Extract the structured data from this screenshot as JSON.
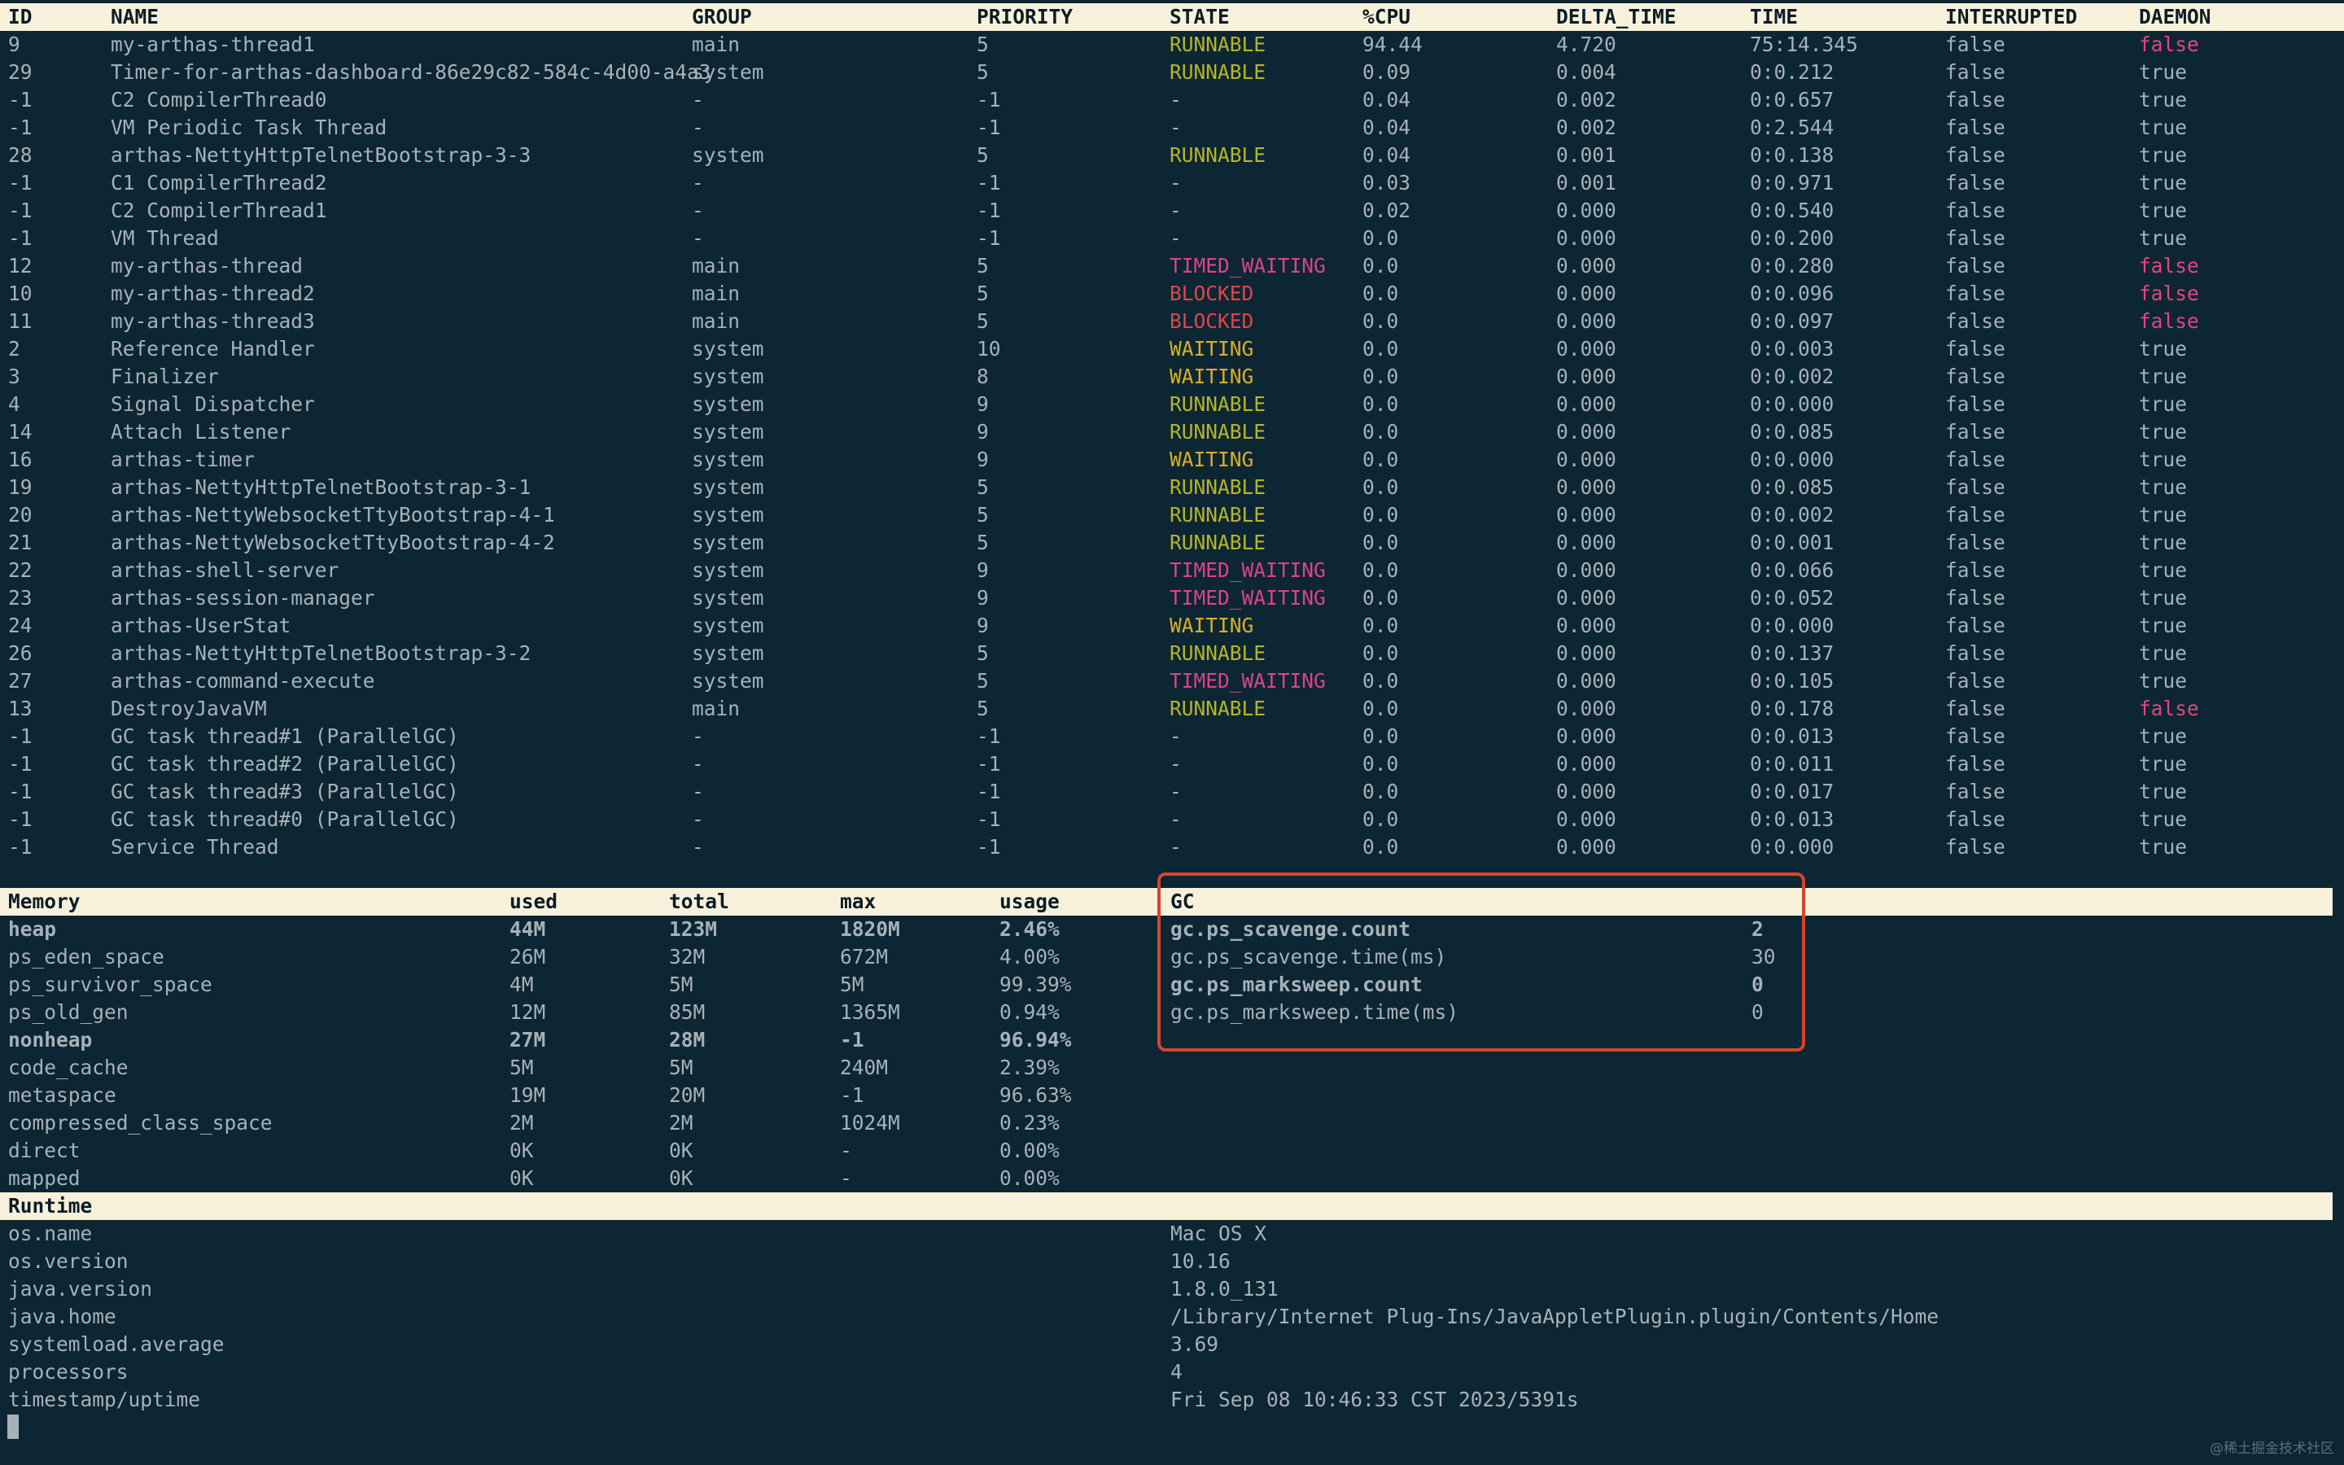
{
  "thread_table": {
    "headers": [
      "ID",
      "NAME",
      "GROUP",
      "PRIORITY",
      "STATE",
      "%CPU",
      "DELTA_TIME",
      "TIME",
      "INTERRUPTED",
      "DAEMON"
    ],
    "rows": [
      [
        "9",
        "my-arthas-thread1",
        "main",
        "5",
        "RUNNABLE",
        "94.44",
        "4.720",
        "75:14.345",
        "false",
        "false"
      ],
      [
        "29",
        "Timer-for-arthas-dashboard-86e29c82-584c-4d00-a4a3",
        "system",
        "5",
        "RUNNABLE",
        "0.09",
        "0.004",
        "0:0.212",
        "false",
        "true"
      ],
      [
        "-1",
        "C2 CompilerThread0",
        "-",
        "-1",
        "-",
        "0.04",
        "0.002",
        "0:0.657",
        "false",
        "true"
      ],
      [
        "-1",
        "VM Periodic Task Thread",
        "-",
        "-1",
        "-",
        "0.04",
        "0.002",
        "0:2.544",
        "false",
        "true"
      ],
      [
        "28",
        "arthas-NettyHttpTelnetBootstrap-3-3",
        "system",
        "5",
        "RUNNABLE",
        "0.04",
        "0.001",
        "0:0.138",
        "false",
        "true"
      ],
      [
        "-1",
        "C1 CompilerThread2",
        "-",
        "-1",
        "-",
        "0.03",
        "0.001",
        "0:0.971",
        "false",
        "true"
      ],
      [
        "-1",
        "C2 CompilerThread1",
        "-",
        "-1",
        "-",
        "0.02",
        "0.000",
        "0:0.540",
        "false",
        "true"
      ],
      [
        "-1",
        "VM Thread",
        "-",
        "-1",
        "-",
        "0.0",
        "0.000",
        "0:0.200",
        "false",
        "true"
      ],
      [
        "12",
        "my-arthas-thread",
        "main",
        "5",
        "TIMED_WAITING",
        "0.0",
        "0.000",
        "0:0.280",
        "false",
        "false"
      ],
      [
        "10",
        "my-arthas-thread2",
        "main",
        "5",
        "BLOCKED",
        "0.0",
        "0.000",
        "0:0.096",
        "false",
        "false"
      ],
      [
        "11",
        "my-arthas-thread3",
        "main",
        "5",
        "BLOCKED",
        "0.0",
        "0.000",
        "0:0.097",
        "false",
        "false"
      ],
      [
        "2",
        "Reference Handler",
        "system",
        "10",
        "WAITING",
        "0.0",
        "0.000",
        "0:0.003",
        "false",
        "true"
      ],
      [
        "3",
        "Finalizer",
        "system",
        "8",
        "WAITING",
        "0.0",
        "0.000",
        "0:0.002",
        "false",
        "true"
      ],
      [
        "4",
        "Signal Dispatcher",
        "system",
        "9",
        "RUNNABLE",
        "0.0",
        "0.000",
        "0:0.000",
        "false",
        "true"
      ],
      [
        "14",
        "Attach Listener",
        "system",
        "9",
        "RUNNABLE",
        "0.0",
        "0.000",
        "0:0.085",
        "false",
        "true"
      ],
      [
        "16",
        "arthas-timer",
        "system",
        "9",
        "WAITING",
        "0.0",
        "0.000",
        "0:0.000",
        "false",
        "true"
      ],
      [
        "19",
        "arthas-NettyHttpTelnetBootstrap-3-1",
        "system",
        "5",
        "RUNNABLE",
        "0.0",
        "0.000",
        "0:0.085",
        "false",
        "true"
      ],
      [
        "20",
        "arthas-NettyWebsocketTtyBootstrap-4-1",
        "system",
        "5",
        "RUNNABLE",
        "0.0",
        "0.000",
        "0:0.002",
        "false",
        "true"
      ],
      [
        "21",
        "arthas-NettyWebsocketTtyBootstrap-4-2",
        "system",
        "5",
        "RUNNABLE",
        "0.0",
        "0.000",
        "0:0.001",
        "false",
        "true"
      ],
      [
        "22",
        "arthas-shell-server",
        "system",
        "9",
        "TIMED_WAITING",
        "0.0",
        "0.000",
        "0:0.066",
        "false",
        "true"
      ],
      [
        "23",
        "arthas-session-manager",
        "system",
        "9",
        "TIMED_WAITING",
        "0.0",
        "0.000",
        "0:0.052",
        "false",
        "true"
      ],
      [
        "24",
        "arthas-UserStat",
        "system",
        "9",
        "WAITING",
        "0.0",
        "0.000",
        "0:0.000",
        "false",
        "true"
      ],
      [
        "26",
        "arthas-NettyHttpTelnetBootstrap-3-2",
        "system",
        "5",
        "RUNNABLE",
        "0.0",
        "0.000",
        "0:0.137",
        "false",
        "true"
      ],
      [
        "27",
        "arthas-command-execute",
        "system",
        "5",
        "TIMED_WAITING",
        "0.0",
        "0.000",
        "0:0.105",
        "false",
        "true"
      ],
      [
        "13",
        "DestroyJavaVM",
        "main",
        "5",
        "RUNNABLE",
        "0.0",
        "0.000",
        "0:0.178",
        "false",
        "false"
      ],
      [
        "-1",
        "GC task thread#1 (ParallelGC)",
        "-",
        "-1",
        "-",
        "0.0",
        "0.000",
        "0:0.013",
        "false",
        "true"
      ],
      [
        "-1",
        "GC task thread#2 (ParallelGC)",
        "-",
        "-1",
        "-",
        "0.0",
        "0.000",
        "0:0.011",
        "false",
        "true"
      ],
      [
        "-1",
        "GC task thread#3 (ParallelGC)",
        "-",
        "-1",
        "-",
        "0.0",
        "0.000",
        "0:0.017",
        "false",
        "true"
      ],
      [
        "-1",
        "GC task thread#0 (ParallelGC)",
        "-",
        "-1",
        "-",
        "0.0",
        "0.000",
        "0:0.013",
        "false",
        "true"
      ],
      [
        "-1",
        "Service Thread",
        "-",
        "-1",
        "-",
        "0.0",
        "0.000",
        "0:0.000",
        "false",
        "true"
      ]
    ]
  },
  "memory_table": {
    "headers": [
      "Memory",
      "used",
      "total",
      "max",
      "usage"
    ],
    "rows": [
      {
        "cells": [
          "heap",
          "44M",
          "123M",
          "1820M",
          "2.46%"
        ],
        "bold": true
      },
      {
        "cells": [
          "ps_eden_space",
          "26M",
          "32M",
          "672M",
          "4.00%"
        ],
        "bold": false
      },
      {
        "cells": [
          "ps_survivor_space",
          "4M",
          "5M",
          "5M",
          "99.39%"
        ],
        "bold": false
      },
      {
        "cells": [
          "ps_old_gen",
          "12M",
          "85M",
          "1365M",
          "0.94%"
        ],
        "bold": false
      },
      {
        "cells": [
          "nonheap",
          "27M",
          "28M",
          "-1",
          "96.94%"
        ],
        "bold": true
      },
      {
        "cells": [
          "code_cache",
          "5M",
          "5M",
          "240M",
          "2.39%"
        ],
        "bold": false
      },
      {
        "cells": [
          "metaspace",
          "19M",
          "20M",
          "-1",
          "96.63%"
        ],
        "bold": false
      },
      {
        "cells": [
          "compressed_class_space",
          "2M",
          "2M",
          "1024M",
          "0.23%"
        ],
        "bold": false
      },
      {
        "cells": [
          "direct",
          "0K",
          "0K",
          "-",
          "0.00%"
        ],
        "bold": false
      },
      {
        "cells": [
          "mapped",
          "0K",
          "0K",
          "-",
          "0.00%"
        ],
        "bold": false
      }
    ]
  },
  "gc_table": {
    "header": "GC",
    "rows": [
      {
        "cells": [
          "gc.ps_scavenge.count",
          "2"
        ],
        "bold": true
      },
      {
        "cells": [
          "gc.ps_scavenge.time(ms)",
          "30"
        ],
        "bold": false
      },
      {
        "cells": [
          "gc.ps_marksweep.count",
          "0"
        ],
        "bold": true
      },
      {
        "cells": [
          "gc.ps_marksweep.time(ms)",
          "0"
        ],
        "bold": false
      }
    ]
  },
  "runtime_table": {
    "header": "Runtime",
    "rows": [
      [
        "os.name",
        "Mac OS X"
      ],
      [
        "os.version",
        "10.16"
      ],
      [
        "java.version",
        "1.8.0_131"
      ],
      [
        "java.home",
        "/Library/Internet Plug-Ins/JavaAppletPlugin.plugin/Contents/Home"
      ],
      [
        "systemload.average",
        "3.69"
      ],
      [
        "processors",
        "4"
      ],
      [
        "timestamp/uptime",
        "Fri Sep 08 10:46:33 CST 2023/5391s"
      ]
    ]
  },
  "watermark": "@稀土掘金技术社区",
  "colors": {
    "background": "#0d2633",
    "text": "#a6b2b8",
    "header_bg": "#f7f1dc",
    "runnable": "#b5b52a",
    "waiting": "#d7ae2a",
    "timed_waiting": "#d9448a",
    "blocked": "#e0454b",
    "daemon_false": "#e8447f",
    "highlight_box": "#d6442d"
  }
}
